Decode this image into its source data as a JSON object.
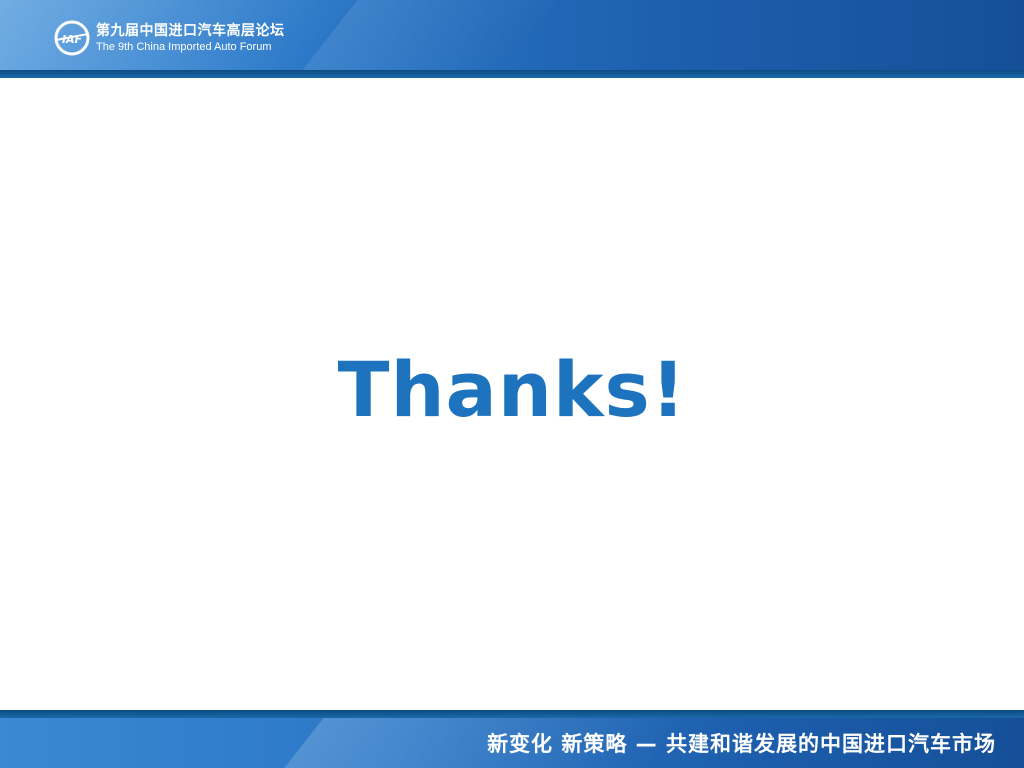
{
  "header": {
    "logo_name": "iaf-logo-icon",
    "logo_letters": "IAF",
    "title_cn": "第九届中国进口汽车高层论坛",
    "title_en": "The 9th China Imported Auto Forum"
  },
  "main": {
    "message": "Thanks!"
  },
  "footer": {
    "slogan": "新变化  新策略 — 共建和谐发展的中国进口汽车市场"
  },
  "colors": {
    "brand_blue": "#1e73be",
    "banner_blue": "#2b78c8",
    "banner_dark": "#164f98"
  }
}
